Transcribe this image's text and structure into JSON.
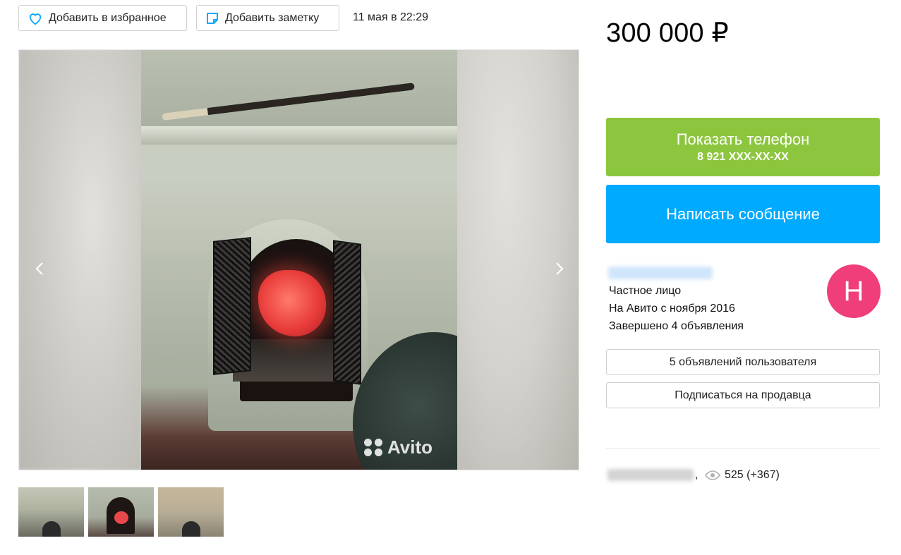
{
  "actions": {
    "favorite_label": "Добавить в избранное",
    "note_label": "Добавить заметку",
    "date": "11 мая в 22:29"
  },
  "gallery": {
    "watermark": "Avito",
    "thumbnails_count": 3,
    "active_thumbnail": 2
  },
  "price": "300 000 ₽",
  "phone": {
    "button_label": "Показать телефон",
    "number": "8 921 XXX-XX-XX"
  },
  "message_button": "Написать сообщение",
  "seller": {
    "type": "Частное лицо",
    "since": "На Авито с ноября 2016",
    "completed": "Завершено 4 объявления",
    "avatar_letter": "Н"
  },
  "seller_buttons": {
    "user_ads": "5 объявлений пользователя",
    "subscribe": "Подписаться на продавца"
  },
  "stats": {
    "views": "525 (+367)"
  },
  "colors": {
    "phone_button": "#8cc63e",
    "message_button": "#00aaff",
    "avatar": "#ef3e7a",
    "accent_icon": "#00aaff"
  },
  "icons": {
    "favorite": "heart-icon",
    "note": "note-icon",
    "prev": "chevron-left-icon",
    "next": "chevron-right-icon",
    "views": "eye-icon"
  }
}
